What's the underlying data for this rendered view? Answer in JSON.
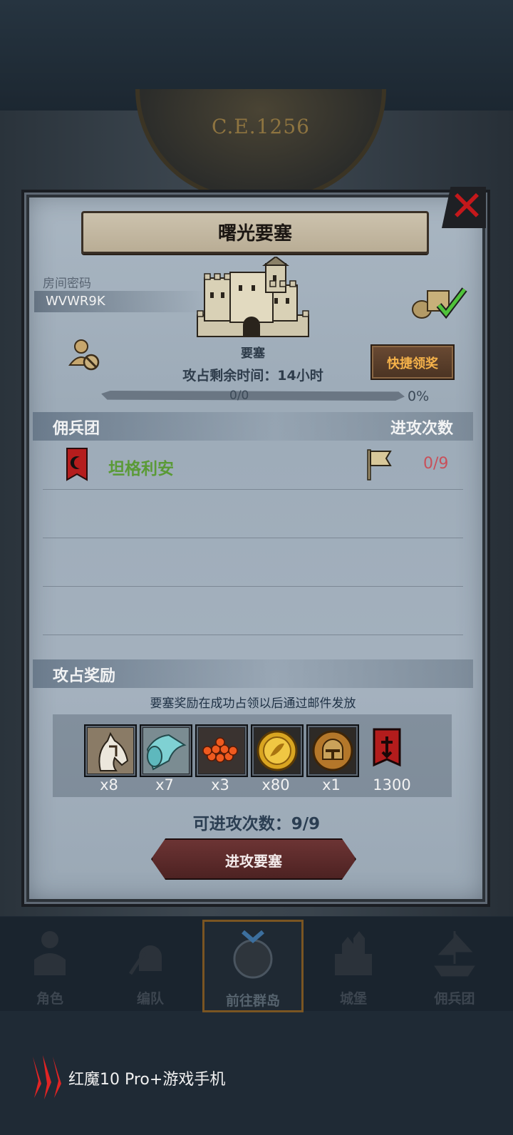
{
  "era": {
    "label": "C.E.1256"
  },
  "dialog": {
    "title": "曙光要塞",
    "close_icon": "close-x-icon",
    "room": {
      "label": "房间密码",
      "code": "WVWR9K"
    },
    "fortress": {
      "label": "要塞"
    },
    "quick_claim": {
      "label": "快捷领奖"
    },
    "remaining_time": "攻占剩余时间：14小时",
    "progress": {
      "count": "0/0",
      "percent_text": "0%",
      "fraction": 0
    },
    "mercenary_header": {
      "left": "佣兵团",
      "right": "进攻次数"
    },
    "mercenaries": [
      {
        "name": "坦格利安",
        "attacks": "0/9"
      }
    ],
    "reward_header": {
      "left": "攻占奖励"
    },
    "reward_note": "要塞奖励在成功占领以后通过邮件发放",
    "rewards": [
      {
        "icon": "horse-icon",
        "qty": "x8"
      },
      {
        "icon": "cloth-icon",
        "qty": "x7"
      },
      {
        "icon": "berries-icon",
        "qty": "x3"
      },
      {
        "icon": "gold-coin-icon",
        "qty": "x80"
      },
      {
        "icon": "knight-helmet-medal-icon",
        "qty": "x1"
      },
      {
        "icon": "mercenary-banner-icon",
        "qty": "1300"
      }
    ],
    "attack_count": "可进攻次数：9/9",
    "attack_button": "进攻要塞"
  },
  "nav": {
    "items": [
      {
        "label": "角色",
        "icon": "character-icon"
      },
      {
        "label": "编队",
        "icon": "formation-icon"
      },
      {
        "label": "前往群岛",
        "icon": "islands-icon",
        "active": true
      },
      {
        "label": "城堡",
        "icon": "castle-icon"
      },
      {
        "label": "佣兵团",
        "icon": "mercenary-ship-icon"
      }
    ]
  },
  "watermark": {
    "text": "红魔10 Pro+游戏手机"
  },
  "colors": {
    "accent_gold": "#f5b24a",
    "mercenary_name": "#5a9a36",
    "attack_count": "#c8505a",
    "close": "#c4181b"
  }
}
